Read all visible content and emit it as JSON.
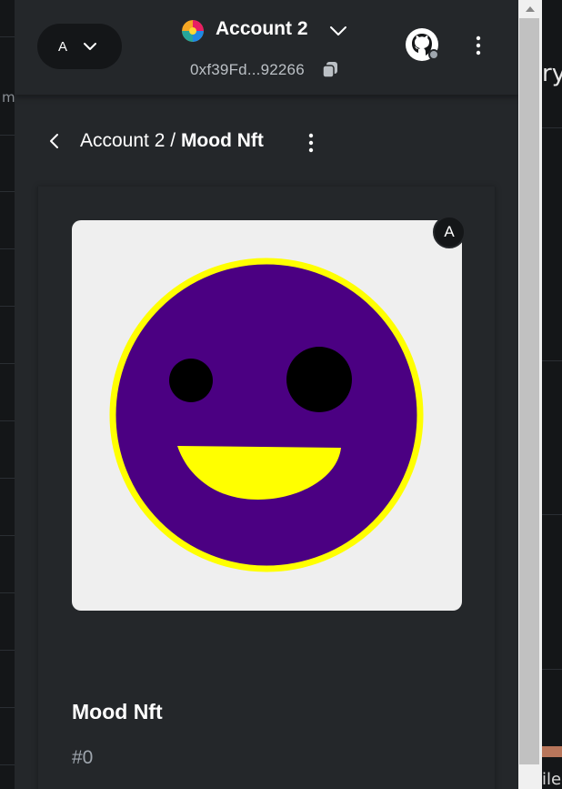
{
  "header": {
    "network_avatar": "A",
    "account_name": "Account 2",
    "account_address": "0xf39Fd...92266",
    "icons": [
      "chevron-down-icon",
      "copy-icon",
      "github-icon",
      "kebab-menu-icon"
    ]
  },
  "breadcrumb": {
    "account": "Account 2",
    "separator": "/",
    "current": "Mood Nft"
  },
  "nft": {
    "badge": "A",
    "title": "Mood Nft",
    "token_id": "#0"
  },
  "background": {
    "left_fragment": "m",
    "right_fragment_top": "ry",
    "right_fragment_bottom": "ile"
  },
  "colors": {
    "popup_bg": "#24272a",
    "page_bg": "#141618",
    "smiley_face": "#4b0082",
    "smiley_border": "#ffff00",
    "smiley_mouth": "#ffff00"
  }
}
